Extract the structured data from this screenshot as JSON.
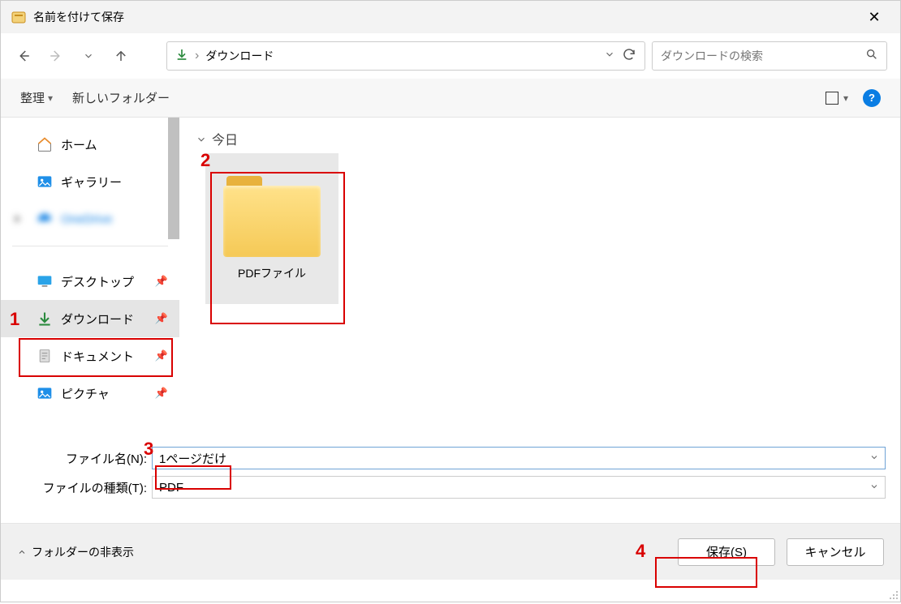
{
  "titlebar": {
    "title": "名前を付けて保存"
  },
  "nav": {
    "path_label": "ダウンロード",
    "search_placeholder": "ダウンロードの検索"
  },
  "toolbar": {
    "organize": "整理",
    "new_folder": "新しいフォルダー"
  },
  "sidebar": {
    "home": "ホーム",
    "gallery": "ギャラリー",
    "blur": "OneDrive",
    "desktop": "デスクトップ",
    "downloads": "ダウンロード",
    "documents": "ドキュメント",
    "pictures": "ピクチャ"
  },
  "content": {
    "group_today": "今日",
    "folder_name": "PDFファイル"
  },
  "inputs": {
    "filename_label": "ファイル名(N):",
    "filename_value": "1ページだけ",
    "filetype_label": "ファイルの種類(T):",
    "filetype_value": "PDF"
  },
  "footer": {
    "hide_folders": "フォルダーの非表示",
    "save": "保存(S)",
    "cancel": "キャンセル"
  },
  "annotations": {
    "a1": "1",
    "a2": "2",
    "a3": "3",
    "a4": "4"
  }
}
